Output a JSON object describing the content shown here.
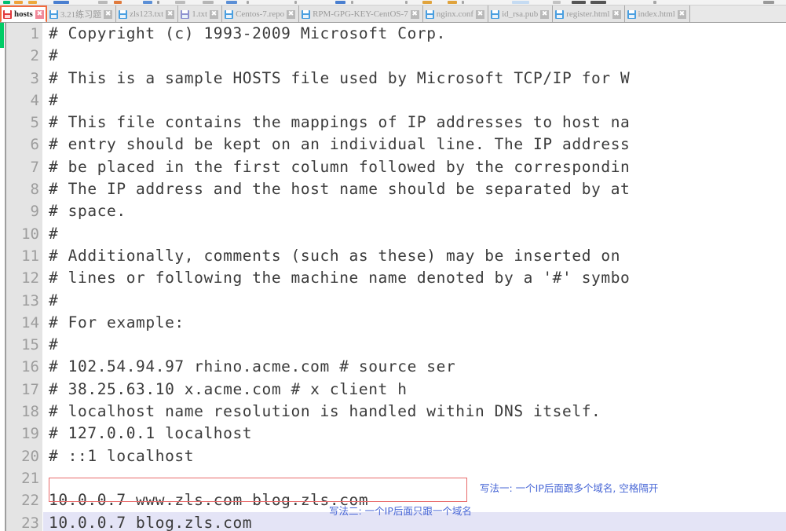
{
  "window": {
    "application": "Notepad++",
    "active_file": "hosts"
  },
  "toolbar": {
    "visible": "partially clipped icon row"
  },
  "tabs": [
    {
      "label": "hosts",
      "icon": "floppy-disk-icon",
      "close": "✖",
      "active": true,
      "icon_color": "#e2393c"
    },
    {
      "label": "3.21练习题",
      "icon": "floppy-disk-icon",
      "close": "✖",
      "active": false,
      "icon_color": "#4a9fe0"
    },
    {
      "label": "zls123.txt",
      "icon": "floppy-disk-icon",
      "close": "✖",
      "active": false,
      "icon_color": "#4a9fe0"
    },
    {
      "label": "1.txt",
      "icon": "floppy-disk-icon",
      "close": "✖",
      "active": false,
      "icon_color": "#8f93d0"
    },
    {
      "label": "Centos-7.repo",
      "icon": "floppy-disk-icon",
      "close": "✖",
      "active": false,
      "icon_color": "#4a9fe0"
    },
    {
      "label": "RPM-GPG-KEY-CentOS-7",
      "icon": "floppy-disk-icon",
      "close": "✖",
      "active": false,
      "icon_color": "#4a9fe0"
    },
    {
      "label": "nginx.conf",
      "icon": "floppy-disk-icon",
      "close": "✖",
      "active": false,
      "icon_color": "#4a9fe0"
    },
    {
      "label": "id_rsa.pub",
      "icon": "floppy-disk-icon",
      "close": "✖",
      "active": false,
      "icon_color": "#4a9fe0"
    },
    {
      "label": "register.html",
      "icon": "floppy-disk-icon",
      "close": "✖",
      "active": false,
      "icon_color": "#4a9fe0"
    },
    {
      "label": "index.html",
      "icon": "floppy-disk-icon",
      "close": "✖",
      "active": false,
      "icon_color": "#4a9fe0"
    }
  ],
  "editor": {
    "change_marker_color": "#00cc66",
    "current_line_highlight": "#e4e4f6",
    "lines": [
      {
        "n": "1",
        "text": "# Copyright (c) 1993-2009 Microsoft Corp."
      },
      {
        "n": "2",
        "text": "#"
      },
      {
        "n": "3",
        "text": "# This is a sample HOSTS file used by Microsoft TCP/IP for W"
      },
      {
        "n": "4",
        "text": "#"
      },
      {
        "n": "5",
        "text": "# This file contains the mappings of IP addresses to host na"
      },
      {
        "n": "6",
        "text": "# entry should be kept on an individual line. The IP address"
      },
      {
        "n": "7",
        "text": "# be placed in the first column followed by the correspondin"
      },
      {
        "n": "8",
        "text": "# The IP address and the host name should be separated by at"
      },
      {
        "n": "9",
        "text": "# space."
      },
      {
        "n": "10",
        "text": "#"
      },
      {
        "n": "11",
        "text": "# Additionally, comments (such as these) may be inserted on"
      },
      {
        "n": "12",
        "text": "# lines or following the machine name denoted by a '#' symbo"
      },
      {
        "n": "13",
        "text": "#"
      },
      {
        "n": "14",
        "text": "# For example:"
      },
      {
        "n": "15",
        "text": "#"
      },
      {
        "n": "16",
        "text": "#      102.54.94.97     rhino.acme.com          # source ser"
      },
      {
        "n": "17",
        "text": "#       38.25.63.10     x.acme.com              # x client h"
      },
      {
        "n": "18",
        "text": "# localhost name resolution is handled within DNS itself."
      },
      {
        "n": "19",
        "text": "#   127.0.0.1       localhost"
      },
      {
        "n": "20",
        "text": "#   ::1             localhost"
      },
      {
        "n": "21",
        "text": ""
      },
      {
        "n": "22",
        "text": "10.0.0.7 www.zls.com blog.zls.com"
      },
      {
        "n": "23",
        "text": "10.0.0.7 blog.zls.com"
      }
    ]
  },
  "annotations": {
    "box_color": "#e86a6a",
    "note_color": "#4766d6",
    "note_1": "写法一: 一个IP后面跟多个域名, 空格隔开",
    "note_2": "写法二: 一个IP后面只跟一个域名"
  }
}
